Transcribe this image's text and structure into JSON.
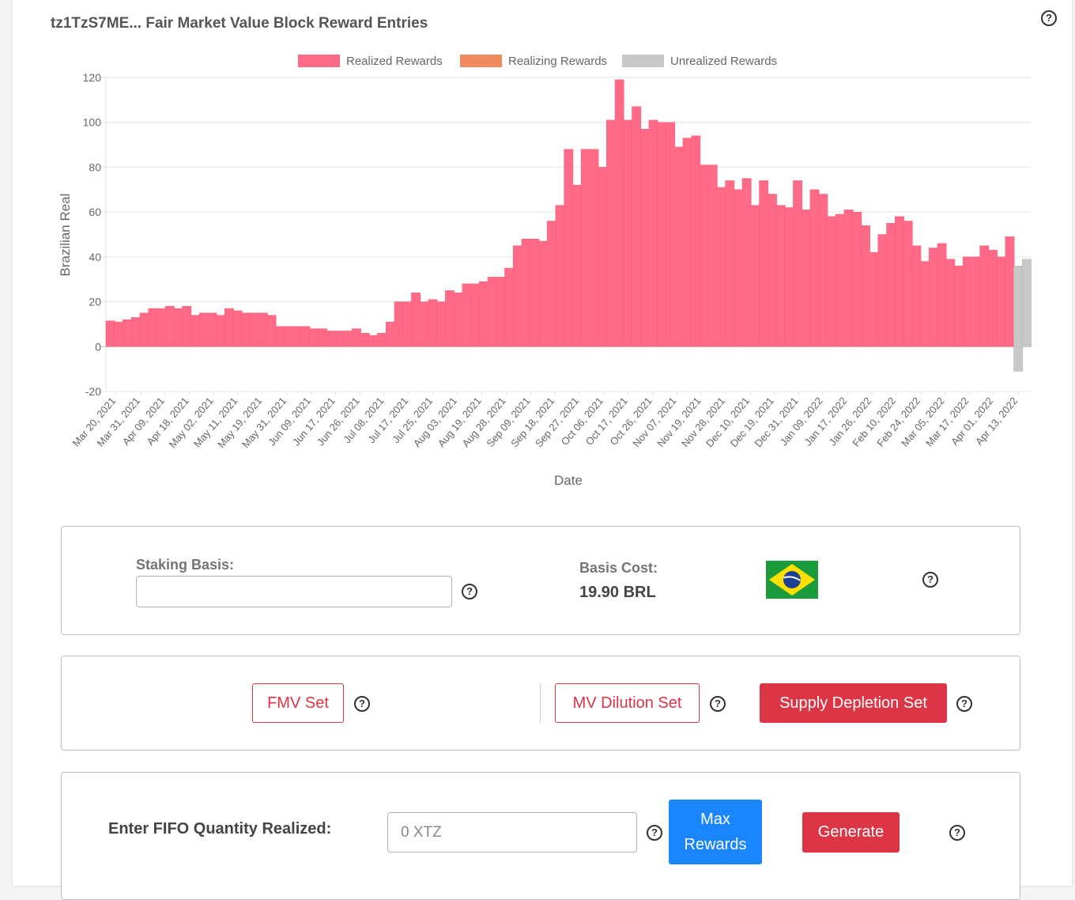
{
  "title": "tz1TzS7ME... Fair Market Value Block Reward Entries",
  "chart_data": {
    "type": "bar",
    "title": "",
    "xlabel": "Date",
    "ylabel": "Brazilian Real",
    "ylim": [
      -20,
      120
    ],
    "yticks": [
      120,
      100,
      80,
      60,
      40,
      20,
      0,
      -20
    ],
    "grid": true,
    "legend_position": "top",
    "colors": {
      "realized": "#ff6b87",
      "realizing": "#f08a5d",
      "unrealized": "#c8c8c8"
    },
    "legend": [
      "Realized Rewards",
      "Realizing Rewards",
      "Unrealized Rewards"
    ],
    "tick_labels": [
      "Mar 20, 2021",
      "Mar 31, 2021",
      "Apr 09, 2021",
      "Apr 18, 2021",
      "May 02, 2021",
      "May 11, 2021",
      "May 19, 2021",
      "May 31, 2021",
      "Jun 09, 2021",
      "Jun 17, 2021",
      "Jun 26, 2021",
      "Jul 08, 2021",
      "Jul 17, 2021",
      "Jul 25, 2021",
      "Aug 03, 2021",
      "Aug 19, 2021",
      "Aug 28, 2021",
      "Sep 09, 2021",
      "Sep 18, 2021",
      "Sep 27, 2021",
      "Oct 06, 2021",
      "Oct 17, 2021",
      "Oct 26, 2021",
      "Nov 07, 2021",
      "Nov 19, 2021",
      "Nov 28, 2021",
      "Dec 10, 2021",
      "Dec 19, 2021",
      "Dec 31, 2021",
      "Jan 09, 2022",
      "Jan 17, 2022",
      "Jan 26, 2022",
      "Feb 10, 2022",
      "Feb 24, 2022",
      "Mar 05, 2022",
      "Mar 17, 2022",
      "Apr 01, 2022",
      "Apr 13, 2022"
    ],
    "series": [
      {
        "name": "Realized Rewards",
        "values": [
          11.5,
          11,
          12,
          13,
          15,
          17,
          17,
          18,
          17,
          18,
          14,
          15,
          15,
          14,
          17,
          16,
          15,
          15,
          15,
          14,
          9,
          9,
          9,
          9,
          8,
          8,
          7,
          7,
          7,
          8,
          6,
          5,
          6,
          11,
          20,
          20,
          24,
          20,
          21,
          20,
          25,
          24,
          28,
          28,
          29,
          31,
          31,
          35,
          45,
          48,
          48,
          47,
          56,
          63,
          88,
          72,
          88,
          88,
          80,
          101,
          119,
          101,
          107,
          97,
          101,
          100,
          100,
          89,
          93,
          94,
          81,
          81,
          71,
          74,
          70,
          75,
          63,
          74,
          68,
          63,
          62,
          74,
          61,
          70,
          68,
          58,
          59,
          61,
          60,
          54,
          42,
          50,
          55,
          58,
          56,
          45,
          38,
          44,
          46,
          39,
          36,
          40,
          40,
          45,
          43,
          40,
          49
        ]
      },
      {
        "name": "Realizing Rewards",
        "values": []
      },
      {
        "name": "Unrealized Rewards",
        "values": [
          -11,
          36,
          39
        ]
      }
    ]
  },
  "staking": {
    "label": "Staking Basis:",
    "value": "",
    "basis_label": "Basis Cost:",
    "basis_value": "19.90 BRL"
  },
  "sets": {
    "fmv": "FMV Set",
    "mv": "MV Dilution Set",
    "supply": "Supply Depletion Set"
  },
  "fifo": {
    "label": "Enter FIFO Quantity Realized:",
    "placeholder": "0 XTZ",
    "max_line1": "Max",
    "max_line2": "Rewards",
    "generate": "Generate"
  },
  "help_glyph": "?",
  "icons": {
    "help": "question-circle-icon",
    "flag": "brazil-flag-icon"
  }
}
